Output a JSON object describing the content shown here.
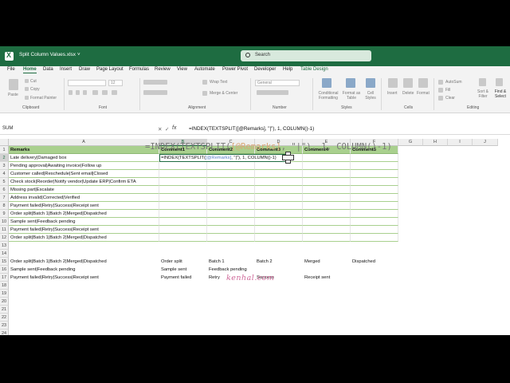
{
  "titlebar": {
    "filename": "Split Column Values.xlsx ˅",
    "search_placeholder": "Search"
  },
  "tabs": [
    "File",
    "Home",
    "Data",
    "Insert",
    "Draw",
    "Page Layout",
    "Formulas",
    "Review",
    "View",
    "Automate",
    "Power Pivot",
    "Developer",
    "Help",
    "Table Design"
  ],
  "active_tab": "Home",
  "ribbon": {
    "paste": "Paste",
    "cut": "Cut",
    "copy": "Copy",
    "format_painter": "Format Painter",
    "font_size": "12",
    "wrap_text": "Wrap Text",
    "merge_center": "Merge & Center",
    "number_format": "General",
    "conditional_formatting": "Conditional Formatting",
    "format_as_table": "Format as Table",
    "cell_styles": "Cell Styles",
    "insert": "Insert",
    "delete": "Delete",
    "format": "Format",
    "autosum": "AutoSum",
    "fill": "Fill",
    "clear": "Clear",
    "sort_filter": "Sort & Filter",
    "find_select": "Find & Select",
    "groups": {
      "clipboard": "Clipboard",
      "font": "Font",
      "alignment": "Alignment",
      "number": "Number",
      "styles": "Styles",
      "cells": "Cells",
      "editing": "Editing"
    }
  },
  "formula_bar": {
    "name_box": "SUM",
    "cancel": "✕",
    "enter": "✓",
    "fx": "fx",
    "formula": "=INDEX(TEXTSPLIT([@Remarks], \"|\"), 1, COLUMN()-1)"
  },
  "columns": [
    "A",
    "B",
    "C",
    "D",
    "E",
    "F",
    "G",
    "H",
    "I",
    "J"
  ],
  "rows": [
    "1",
    "2",
    "3",
    "4",
    "5",
    "6",
    "7",
    "8",
    "9",
    "10",
    "11",
    "12",
    "13",
    "14",
    "15",
    "16",
    "17",
    "18",
    "19",
    "20",
    "21",
    "22",
    "23",
    "24"
  ],
  "table": {
    "headers": [
      "Remarks",
      "Comment1",
      "Comment2",
      "Comment3",
      "Comment4",
      "Comment5"
    ],
    "remarks": [
      "Late delivery|Damaged box",
      "Pending approval|Awaiting invoice|Follow up",
      "Customer called|Reschedule|Sent email|Closed",
      "Check stock|Reorder|Notify vendor|Update ERP|Confirm ETA",
      "Missing part|Escalate",
      "Address invalid|Corrected|Verified",
      "Payment failed|Retry|Success|Receipt sent",
      "Order split|Batch 1|Batch 2|Merged|Dispatched",
      "Sample sent|Feedback pending",
      "Payment failed|Retry|Success|Receipt sent",
      "Order split|Batch 1|Batch 2|Merged|Dispatched"
    ],
    "editing_cell": {
      "prefix": "=INDEX(TEXTSPLIT(",
      "ref": "[@Remarks]",
      "suffix": ", \"|\"), 1, COLUMN()-1)"
    }
  },
  "lower_rows": [
    [
      "Order split|Batch 1|Batch 2|Merged|Dispatched",
      "Order split",
      "Batch 1",
      "Batch 2",
      "Merged",
      "Dispatched"
    ],
    [
      "Sample sent|Feedback pending",
      "Sample sent",
      "Feedback pending",
      "",
      "",
      ""
    ],
    [
      "Payment failed|Retry|Success|Receipt sent",
      "Payment failed",
      "Retry",
      "Success",
      "Receipt sent",
      ""
    ]
  ],
  "overlay": {
    "prefix": "=INDEX(TEXTSPLIT(",
    "ref": "[@Remarks]",
    "suffix": ", \"|\"), 1, COLUMN()-1)"
  },
  "watermark": "kenhal.com"
}
